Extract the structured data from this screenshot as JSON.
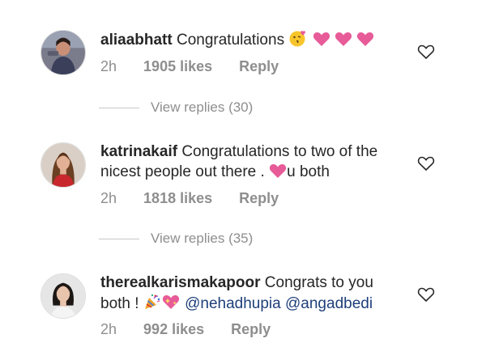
{
  "comments": [
    {
      "username": "aliaabhatt",
      "text_before": "Congratulations",
      "text_after": "",
      "time": "2h",
      "likes": "1905 likes",
      "reply": "Reply",
      "view_replies": "View replies (30)",
      "avatar": "avatar-photo"
    },
    {
      "username": "katrinakaif",
      "text_before": "Congratulations to two of the nicest people out there .",
      "text_after": "u both",
      "time": "2h",
      "likes": "1818 likes",
      "reply": "Reply",
      "view_replies": "View replies (35)",
      "avatar": "avatar-photo"
    },
    {
      "username": "therealkarismakapoor",
      "text_before": "Congrats to you both !",
      "mention_1": "@nehadhupia",
      "mention_2": "@angadbedi",
      "time": "2h",
      "likes": "992 likes",
      "reply": "Reply",
      "avatar": "avatar-photo"
    }
  ],
  "colors": {
    "text": "#262626",
    "secondary": "#8e8e8e",
    "mention": "#1e3f7a",
    "emoji_heart": "#e75b98"
  },
  "icons": {
    "like": "heart-outline-icon",
    "emoji_kiss": "kissing-face-icon",
    "emoji_heart": "pink-heart-icon",
    "emoji_party": "party-popper-icon",
    "emoji_sparkle_heart": "sparkling-heart-icon"
  }
}
